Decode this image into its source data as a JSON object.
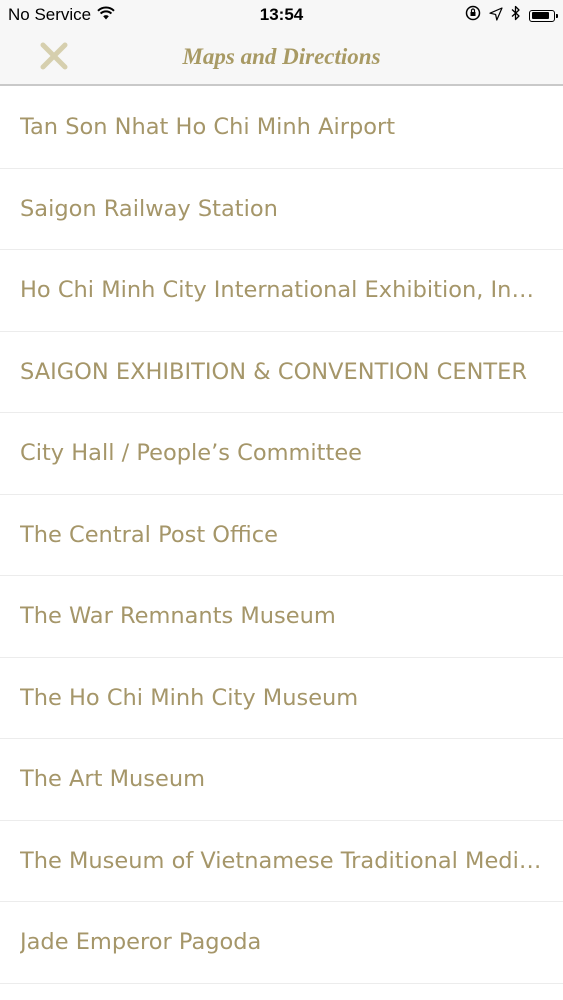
{
  "status_bar": {
    "carrier": "No Service",
    "time": "13:54",
    "battery_level": 0.85,
    "icons": [
      "wifi-icon",
      "orientation-lock-icon",
      "location-arrow-icon",
      "bluetooth-icon",
      "battery-icon"
    ]
  },
  "nav": {
    "title": "Maps and Directions",
    "close_icon": "close-icon"
  },
  "colors": {
    "accent": "#a59669",
    "close_icon": "#d6cfae",
    "nav_background": "#f7f7f7",
    "divider": "#ececec"
  },
  "locations": [
    "Tan Son Nhat Ho Chi Minh Airport",
    "Saigon Railway Station",
    "Ho Chi Minh City International Exhibition, Incentive and Convention Center",
    "SAIGON EXHIBITION & CONVENTION CENTER",
    "City Hall / People’s Committee",
    "The Central Post Office",
    "The War Remnants Museum",
    "The Ho Chi Minh City Museum",
    "The Art Museum",
    "The Museum of Vietnamese Traditional Medicine",
    "Jade Emperor Pagoda"
  ]
}
